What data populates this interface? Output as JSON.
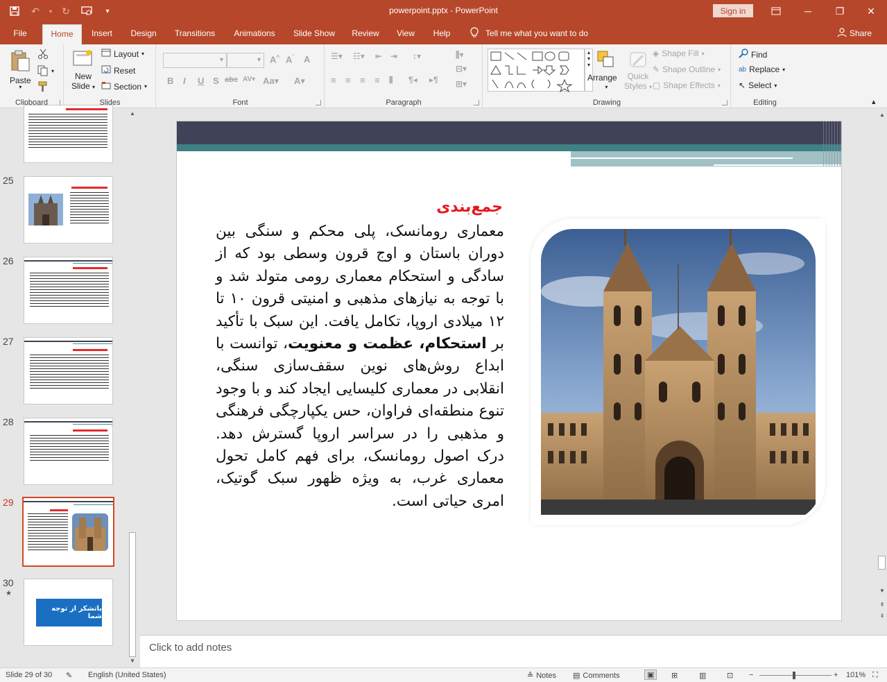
{
  "window": {
    "title": "powerpoint.pptx - PowerPoint",
    "signin_label": "Sign in",
    "share_label": "Share",
    "tellme_label": "Tell me what you want to do"
  },
  "tabs": [
    {
      "label": "File"
    },
    {
      "label": "Home"
    },
    {
      "label": "Insert"
    },
    {
      "label": "Design"
    },
    {
      "label": "Transitions"
    },
    {
      "label": "Animations"
    },
    {
      "label": "Slide Show"
    },
    {
      "label": "Review"
    },
    {
      "label": "View"
    },
    {
      "label": "Help"
    }
  ],
  "ribbon": {
    "clipboard": {
      "label": "Clipboard",
      "paste": "Paste"
    },
    "slides": {
      "label": "Slides",
      "new_slide_1": "New",
      "new_slide_2": "Slide",
      "layout": "Layout",
      "reset": "Reset",
      "section": "Section"
    },
    "font": {
      "label": "Font"
    },
    "paragraph": {
      "label": "Paragraph"
    },
    "drawing": {
      "label": "Drawing",
      "arrange": "Arrange",
      "quick_styles_1": "Quick",
      "quick_styles_2": "Styles",
      "shape_fill": "Shape Fill",
      "shape_outline": "Shape Outline",
      "shape_effects": "Shape Effects"
    },
    "editing": {
      "label": "Editing",
      "find": "Find",
      "replace": "Replace",
      "select": "Select"
    }
  },
  "thumbnails": [
    {
      "number": "25"
    },
    {
      "number": "26"
    },
    {
      "number": "27"
    },
    {
      "number": "28"
    },
    {
      "number": "29"
    },
    {
      "number": "30"
    }
  ],
  "thumb30_text": "باتشکر از توجه شما",
  "slide": {
    "title": "جمع‌بندی",
    "body_1": "معماری رومانسک، پلی محکم و سنگی بین دوران باستان و اوج قرون وسطی بود که از سادگی و استحکام معماری رومی متولد شد و با توجه به نیازهای مذهبی و امنیتی قرون ۱۰ تا ۱۲ میلادی اروپا، تکامل یافت. این سبک با تأکید بر ",
    "body_bold": "استحکام، عظمت و معنویت",
    "body_2": "، توانست با ابداع روش‌های نوین سقف‌سازی سنگی، انقلابی در معماری کلیسایی ایجاد کند و با وجود تنوع منطقه‌ای فراوان، حس یکپارچگی فرهنگی و مذهبی را در سراسر اروپا گسترش دهد. درک اصول رومانسک، برای فهم کامل تحول معماری غرب، به ویژه ظهور سبک گوتیک، امری حیاتی است."
  },
  "notes_placeholder": "Click to add notes",
  "status": {
    "slide_info": "Slide 29 of 30",
    "language": "English (United States)",
    "notes": "Notes",
    "comments": "Comments",
    "zoom": "101%"
  },
  "colors": {
    "brand": "#b7472a",
    "slide_title": "#e3191f",
    "banner_dark": "#404257",
    "banner_teal": "#3e8184"
  }
}
